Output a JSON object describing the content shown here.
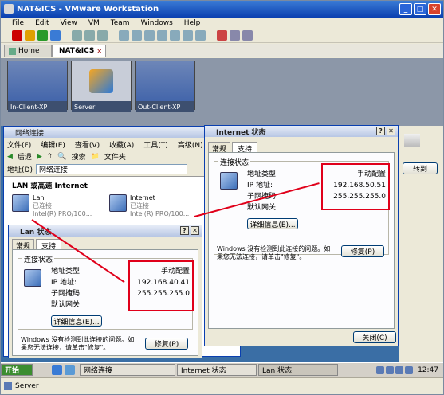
{
  "window": {
    "title": "NAT&ICS - VMware Workstation"
  },
  "menu": [
    "File",
    "Edit",
    "View",
    "VM",
    "Team",
    "Windows",
    "Help"
  ],
  "tabs": [
    {
      "label": "Home"
    },
    {
      "label": "NAT&ICS"
    }
  ],
  "thumbnails": [
    {
      "label": "In-Client-XP"
    },
    {
      "label": "Server"
    },
    {
      "label": "Out-Client-XP"
    }
  ],
  "explorer": {
    "title": "网络连接",
    "menu": [
      "文件(F)",
      "编辑(E)",
      "查看(V)",
      "收藏(A)",
      "工具(T)",
      "高级(N)"
    ],
    "toolbar": {
      "back": "后退",
      "search": "搜索",
      "folders": "文件夹"
    },
    "address_label": "地址(D)",
    "address_value": "网络连接",
    "go_label": "转到",
    "section": "LAN 或高速 Internet",
    "connections": [
      {
        "name": "Lan",
        "status": "已连接",
        "device": "Intel(R) PRO/100..."
      },
      {
        "name": "Internet",
        "status": "已连接",
        "device": "Intel(R) PRO/100..."
      }
    ]
  },
  "dialog_internet": {
    "title": "Internet 状态",
    "tabs": [
      "常规",
      "支持"
    ],
    "group": "连接状态",
    "rows": [
      [
        "地址类型:",
        "手动配置"
      ],
      [
        "IP 地址:",
        "192.168.50.51"
      ],
      [
        "子网掩码:",
        "255.255.255.0"
      ],
      [
        "默认网关:",
        ""
      ]
    ],
    "details_btn": "详细信息(E)...",
    "message": "Windows 没有检测到此连接的问题。如果您无法连接，请单击\"修复\"。",
    "repair_btn": "修复(P)",
    "close_btn": "关闭(C)"
  },
  "dialog_lan": {
    "title": "Lan 状态",
    "tabs": [
      "常规",
      "支持"
    ],
    "group": "连接状态",
    "rows": [
      [
        "地址类型:",
        "手动配置"
      ],
      [
        "IP 地址:",
        "192.168.40.41"
      ],
      [
        "子网掩码:",
        "255.255.255.0"
      ],
      [
        "默认网关:",
        ""
      ]
    ],
    "details_btn": "详细信息(E)...",
    "message": "Windows 没有检测到此连接的问题。如果您无法连接，请单击\"修复\"。",
    "repair_btn": "修复(P)"
  },
  "taskbar": {
    "start": "开始",
    "items": [
      "网络连接",
      "Internet 状态",
      "Lan 状态"
    ],
    "clock": "12:47"
  },
  "statusbar": {
    "label": "Server"
  }
}
